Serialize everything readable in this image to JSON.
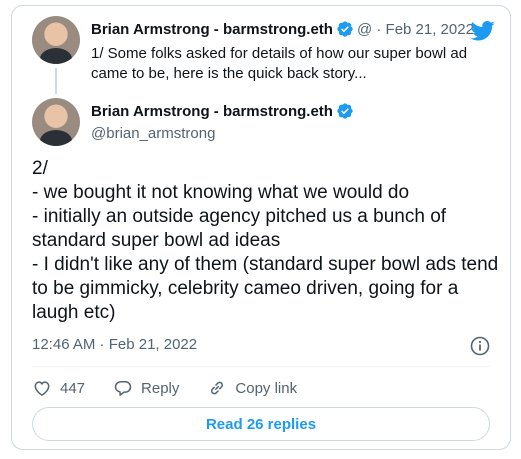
{
  "parent_tweet": {
    "author_name": "Brian Armstrong - barmstrong.eth",
    "meta": "@ · Feb 21, 2022",
    "text": "1/ Some folks asked for details of how our super bowl ad came to be, here is the quick back story..."
  },
  "tweet": {
    "author_name": "Brian Armstrong - barmstrong.eth",
    "handle": "@brian_armstrong",
    "text": "2/\n- we bought it not knowing what we would do\n- initially an outside agency pitched us a bunch of standard super bowl ad ideas\n- I didn't like any of them (standard super bowl ads tend to be gimmicky, celebrity cameo driven, going for a laugh etc)",
    "timestamp": "12:46 AM · Feb 21, 2022"
  },
  "actions": {
    "like_count": "447",
    "reply_label": "Reply",
    "copy_link_label": "Copy link"
  },
  "read_replies_label": "Read 26 replies",
  "colors": {
    "accent": "#1d9bf0",
    "text": "#0f1419",
    "secondary": "#536471",
    "border": "#cfd9de"
  },
  "icons": [
    "verified-badge-icon",
    "twitter-bird-icon",
    "info-icon",
    "heart-icon",
    "reply-icon",
    "link-icon"
  ]
}
